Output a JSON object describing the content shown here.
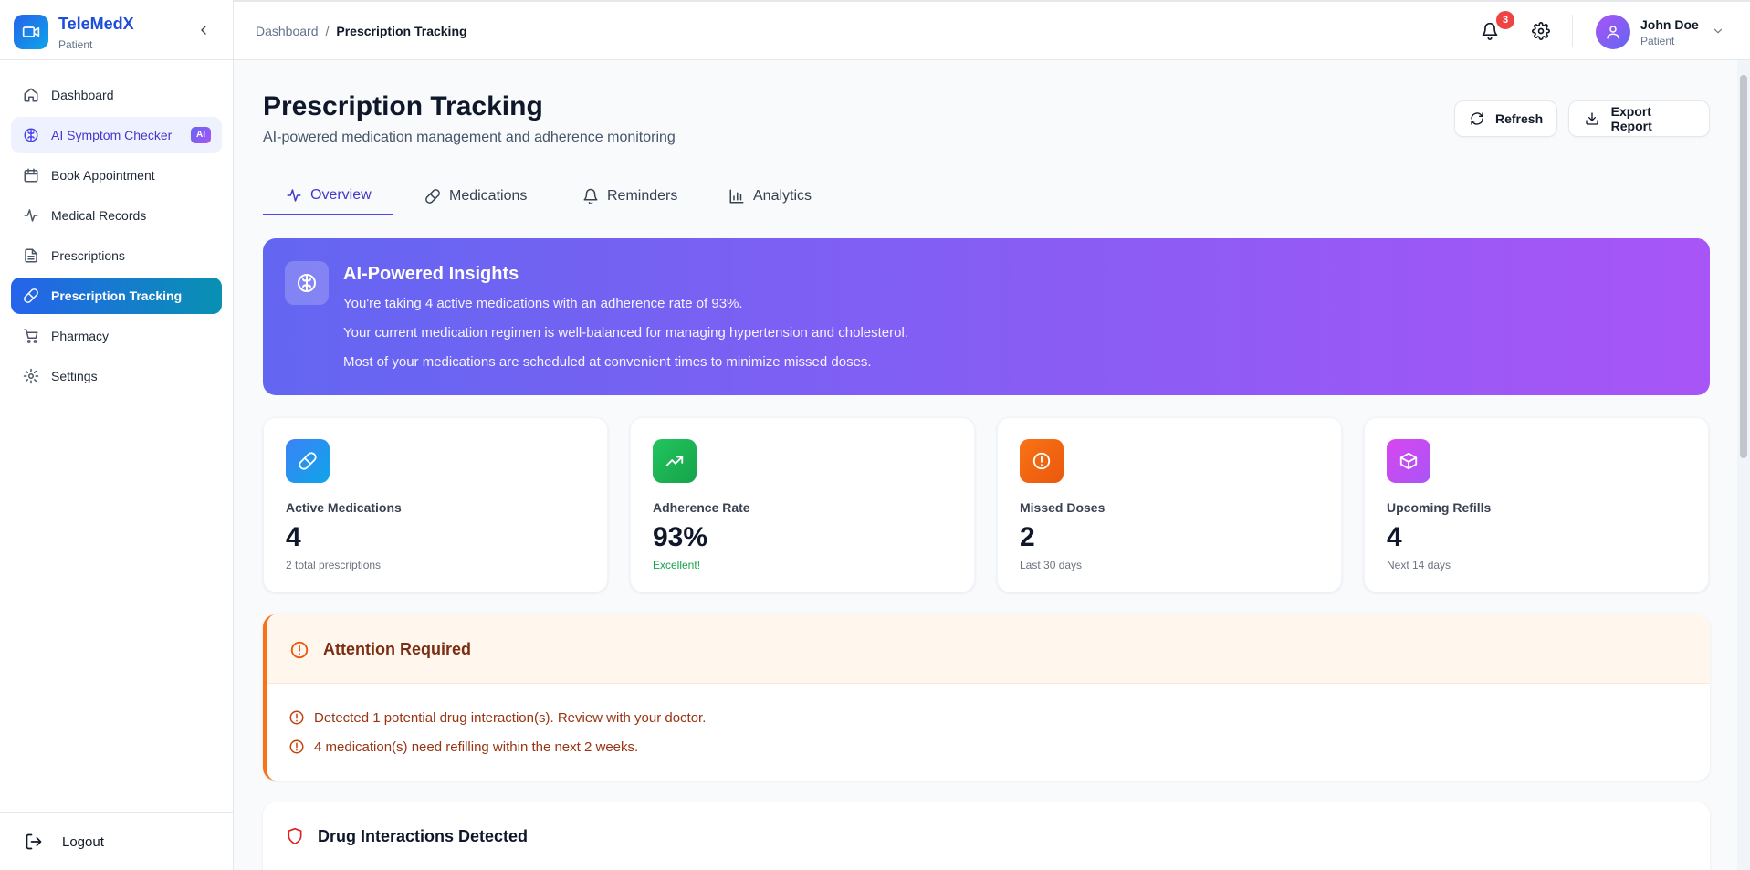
{
  "brand": {
    "name": "TeleMedX",
    "role": "Patient"
  },
  "sidebar": {
    "items": [
      {
        "label": "Dashboard",
        "icon": "home-icon"
      },
      {
        "label": "AI Symptom Checker",
        "icon": "brain-icon",
        "badge": "AI"
      },
      {
        "label": "Book Appointment",
        "icon": "calendar-icon"
      },
      {
        "label": "Medical Records",
        "icon": "activity-icon"
      },
      {
        "label": "Prescriptions",
        "icon": "file-text-icon"
      },
      {
        "label": "Prescription Tracking",
        "icon": "pill-icon"
      },
      {
        "label": "Pharmacy",
        "icon": "shopping-cart-icon"
      },
      {
        "label": "Settings",
        "icon": "gear-icon"
      }
    ],
    "logout": "Logout"
  },
  "header": {
    "breadcrumb_root": "Dashboard",
    "breadcrumb_sep": "/",
    "breadcrumb_current": "Prescription Tracking",
    "notification_count": "3",
    "user_name": "John Doe",
    "user_role": "Patient"
  },
  "page": {
    "title": "Prescription Tracking",
    "subtitle": "AI-powered medication management and adherence monitoring",
    "refresh_label": "Refresh",
    "export_label": "Export Report"
  },
  "tabs": [
    {
      "label": "Overview",
      "icon": "activity-icon"
    },
    {
      "label": "Medications",
      "icon": "pill-icon"
    },
    {
      "label": "Reminders",
      "icon": "bell-icon"
    },
    {
      "label": "Analytics",
      "icon": "bar-chart-icon"
    }
  ],
  "insights": {
    "title": "AI-Powered Insights",
    "lines": [
      "You're taking 4 active medications with an adherence rate of 93%.",
      "Your current medication regimen is well-balanced for managing hypertension and cholesterol.",
      "Most of your medications are scheduled at convenient times to minimize missed doses."
    ]
  },
  "stats": [
    {
      "label": "Active Medications",
      "value": "4",
      "note": "2 total prescriptions",
      "icon": "pill-icon",
      "color": "#0ea5e9"
    },
    {
      "label": "Adherence Rate",
      "value": "93%",
      "note": "Excellent!",
      "icon": "trending-up-icon",
      "color": "#22c55e"
    },
    {
      "label": "Missed Doses",
      "value": "2",
      "note": "Last 30 days",
      "icon": "alert-circle-icon",
      "color": "#f97316"
    },
    {
      "label": "Upcoming Refills",
      "value": "4",
      "note": "Next 14 days",
      "icon": "package-icon",
      "color": "#c026d3"
    }
  ],
  "attention": {
    "title": "Attention Required",
    "items": [
      "Detected 1 potential drug interaction(s). Review with your doctor.",
      "4 medication(s) need refilling within the next 2 weeks."
    ]
  },
  "interactions": {
    "title": "Drug Interactions Detected"
  }
}
